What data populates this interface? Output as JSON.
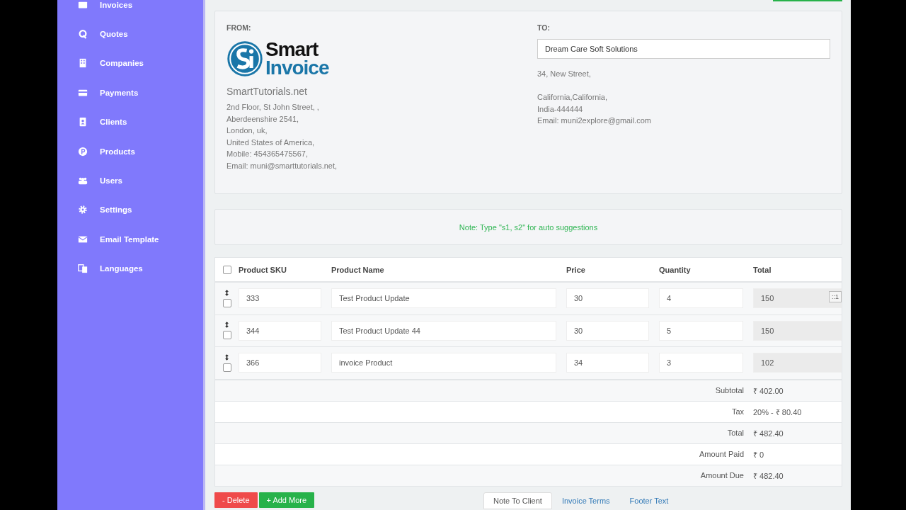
{
  "sidebar": {
    "items": [
      {
        "label": "Invoices"
      },
      {
        "label": "Quotes"
      },
      {
        "label": "Companies"
      },
      {
        "label": "Payments"
      },
      {
        "label": "Clients"
      },
      {
        "label": "Products"
      },
      {
        "label": "Users"
      },
      {
        "label": "Settings"
      },
      {
        "label": "Email Template"
      },
      {
        "label": "Languages"
      }
    ]
  },
  "from": {
    "heading": "FROM:",
    "logo_top": "Smart",
    "logo_bottom": "Invoice",
    "company": "SmartTutorials.net",
    "lines": [
      "2nd Floor, St John Street, ,",
      "Aberdeenshire 2541,",
      "London, uk,",
      "United States of America,",
      "Mobile: 454365475567,",
      "Email: muni@smarttutorials.net,"
    ]
  },
  "to": {
    "heading": "TO:",
    "client": "Dream Care Soft Solutions",
    "paragraphs": [
      [
        "34, New Street,"
      ],
      [
        "California,California,",
        "India-444444",
        "Email: muni2explore@gmail.com"
      ]
    ]
  },
  "note": "Note: Type \"s1, s2\" for auto suggestions",
  "table": {
    "select_all": {
      "checked": false
    },
    "columns": [
      "Product SKU",
      "Product Name",
      "Price",
      "Quantity",
      "Total"
    ],
    "rows": [
      {
        "checked": false,
        "sku": "333",
        "name": "Test Product Update",
        "price": "30",
        "quantity": "4",
        "total": "150",
        "tooltip": "::1"
      },
      {
        "checked": false,
        "sku": "344",
        "name": "Test Product Update 44",
        "price": "30",
        "quantity": "5",
        "total": "150"
      },
      {
        "checked": false,
        "sku": "366",
        "name": "invoice Product",
        "price": "34",
        "quantity": "3",
        "total": "102"
      }
    ]
  },
  "summary": [
    {
      "label": "Subtotal",
      "value": "₹ 402.00"
    },
    {
      "label": "Tax",
      "value": "20% - ₹ 80.40"
    },
    {
      "label": "Total",
      "value": "₹ 482.40"
    },
    {
      "label": "Amount Paid",
      "value": "₹ 0"
    },
    {
      "label": "Amount Due",
      "value": "₹ 482.40"
    }
  ],
  "actions": [
    {
      "label": "- Delete",
      "kind": "danger"
    },
    {
      "label": "+ Add More",
      "kind": "success"
    }
  ],
  "tabs": [
    {
      "label": "Note To Client",
      "selected": true
    },
    {
      "label": "Invoice Terms",
      "selected": false
    },
    {
      "label": "Footer Text",
      "selected": false
    }
  ]
}
